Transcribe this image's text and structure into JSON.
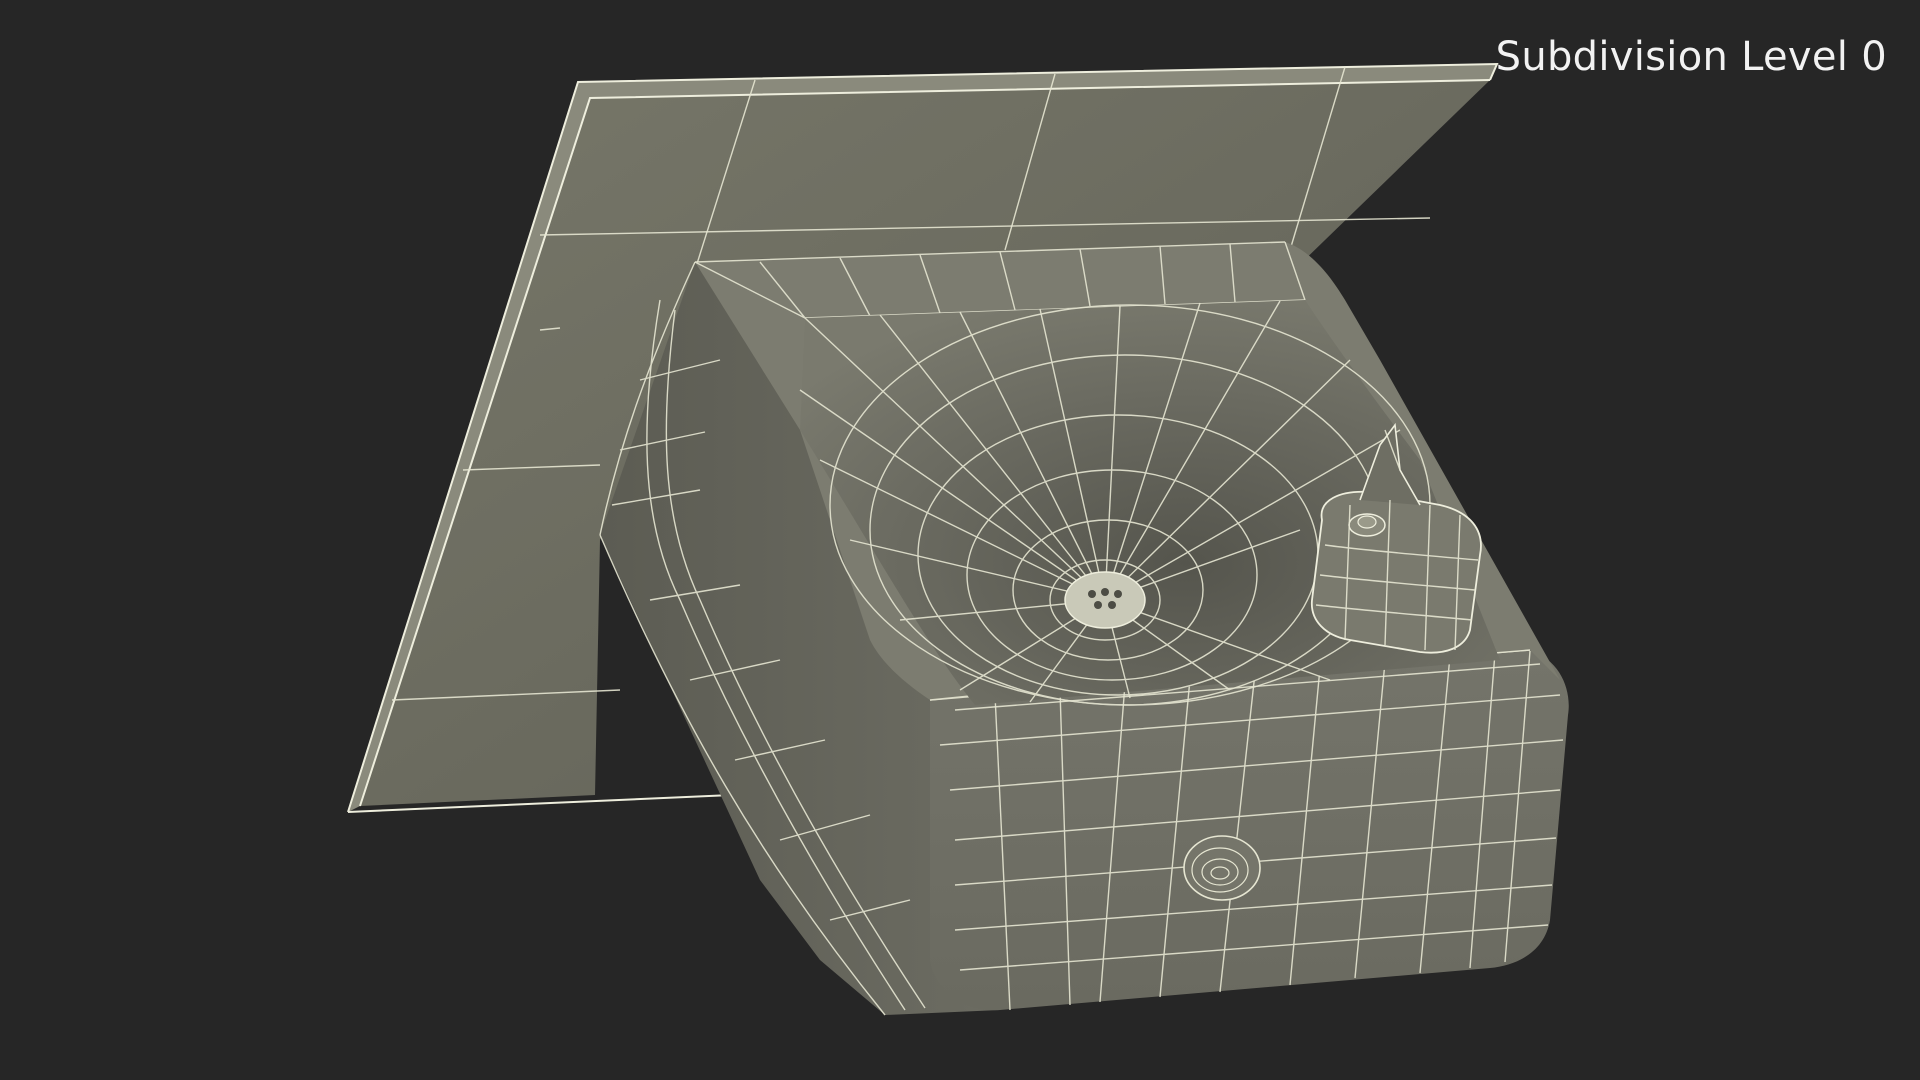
{
  "overlay": {
    "label": "Subdivision Level 0"
  },
  "colors": {
    "background": "#262626",
    "surface": "#6f6f64",
    "surface_dark": "#5d5d54",
    "wireframe": "#e6e6d2"
  }
}
